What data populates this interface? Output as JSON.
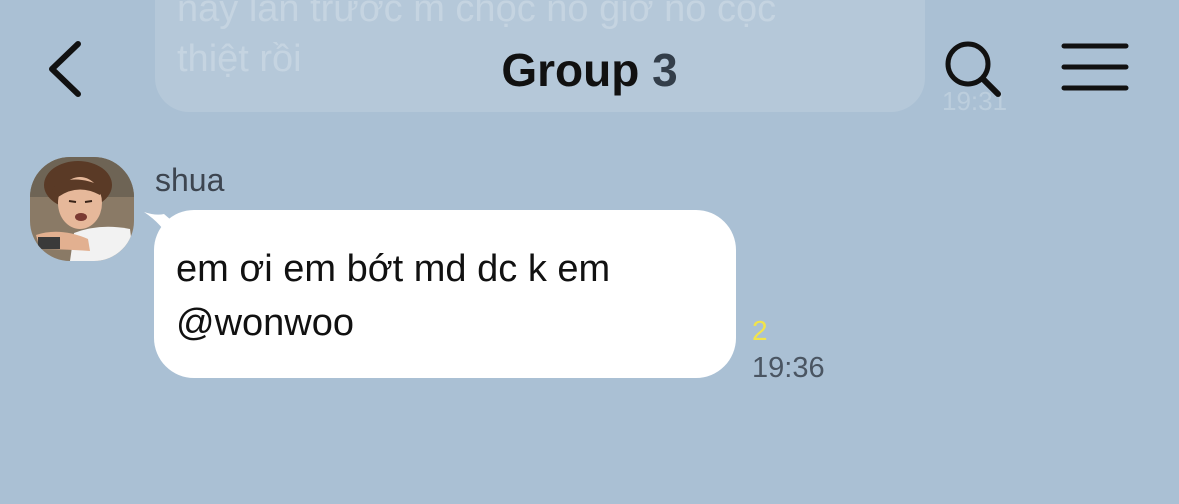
{
  "previous_message": {
    "text_line1": "này lần trước m chọc nó giờ nó cọc",
    "text_line2": "thiệt rồi",
    "time": "19:31"
  },
  "header": {
    "title": "Group",
    "member_count": "3",
    "icons": {
      "back": "chevron-left-icon",
      "search": "search-icon",
      "menu": "hamburger-menu-icon"
    }
  },
  "message": {
    "sender": "shua",
    "line1": "em ơi em bớt md dc k em",
    "line2": "@wonwoo",
    "read_count": "2",
    "time": "19:36"
  },
  "colors": {
    "background": "#aac0d4",
    "bubble": "#ffffff",
    "read_count": "#f2e44a"
  }
}
